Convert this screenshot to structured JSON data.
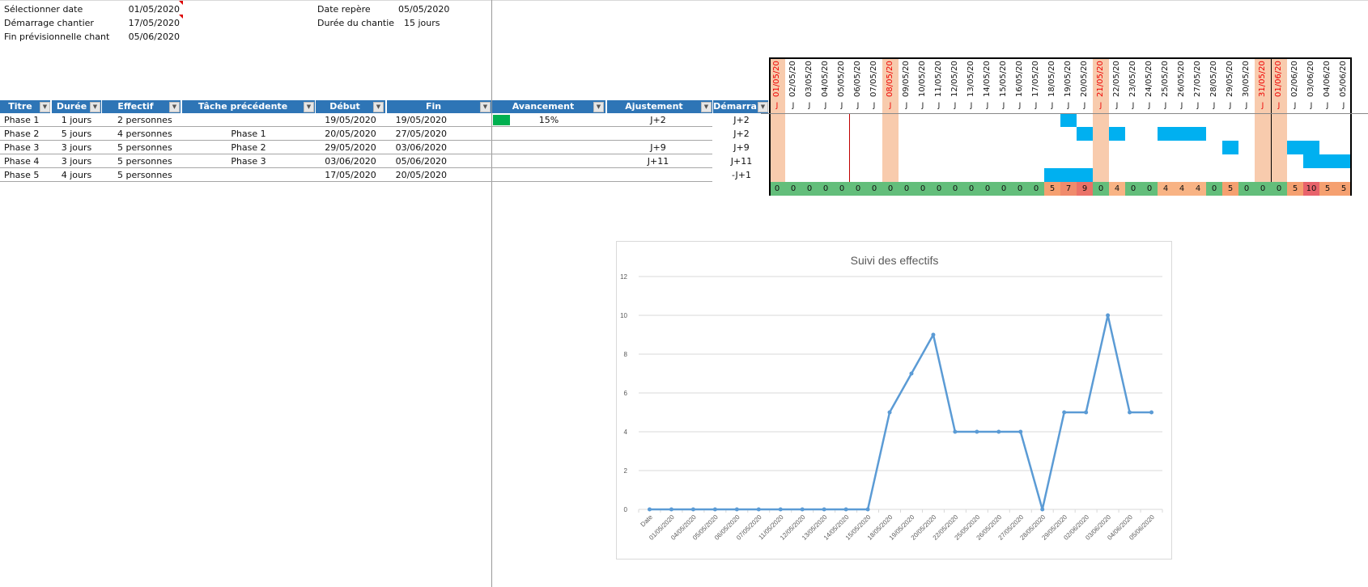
{
  "info": {
    "select_date_label": "Sélectionner date",
    "select_date_value": "01/05/2020",
    "start_label": "Démarrage chantier",
    "start_value": "17/05/2020",
    "end_label": "Fin prévisionnelle chant",
    "end_value": "05/06/2020",
    "ref_date_label": "Date repère",
    "ref_date_value": "05/05/2020",
    "duration_label": "Durée du chantie",
    "duration_value": "15 jours"
  },
  "table": {
    "headers": [
      "Titre",
      "Durée",
      "Effectif",
      "Tâche précédente",
      "Début",
      "Fin",
      "Avancement",
      "Ajustement",
      "Démarra"
    ],
    "rows": [
      {
        "titre": "Phase 1",
        "duree": "1 jours",
        "effectif": "2 personnes",
        "prec": "",
        "debut": "19/05/2020",
        "fin": "19/05/2020",
        "avancement": "15%",
        "avancement_fraction": 0.15,
        "ajustement": "J+2",
        "demarrage": "J+2"
      },
      {
        "titre": "Phase 2",
        "duree": "5 jours",
        "effectif": "4 personnes",
        "prec": "Phase 1",
        "debut": "20/05/2020",
        "fin": "27/05/2020",
        "avancement": "",
        "ajustement": "",
        "demarrage": "J+2"
      },
      {
        "titre": "Phase 3",
        "duree": "3 jours",
        "effectif": "5 personnes",
        "prec": "Phase 2",
        "debut": "29/05/2020",
        "fin": "03/06/2020",
        "avancement": "",
        "ajustement": "J+9",
        "demarrage": "J+9"
      },
      {
        "titre": "Phase 4",
        "duree": "3 jours",
        "effectif": "5 personnes",
        "prec": "Phase 3",
        "debut": "03/06/2020",
        "fin": "05/06/2020",
        "avancement": "",
        "ajustement": "J+11",
        "demarrage": "J+11"
      },
      {
        "titre": "Phase 5",
        "duree": "4 jours",
        "effectif": "5 personnes",
        "prec": "",
        "debut": "17/05/2020",
        "fin": "20/05/2020",
        "avancement": "",
        "ajustement": "",
        "demarrage": "-J+1"
      }
    ]
  },
  "gantt": {
    "dates": [
      "01/05/20",
      "02/05/20",
      "03/05/20",
      "04/05/20",
      "05/05/20",
      "06/05/20",
      "07/05/20",
      "08/05/20",
      "09/05/20",
      "10/05/20",
      "11/05/20",
      "12/05/20",
      "13/05/20",
      "14/05/20",
      "15/05/20",
      "16/05/20",
      "17/05/20",
      "18/05/20",
      "19/05/20",
      "20/05/20",
      "21/05/20",
      "22/05/20",
      "23/05/20",
      "24/05/20",
      "25/05/20",
      "26/05/20",
      "27/05/20",
      "28/05/20",
      "29/05/20",
      "30/05/20",
      "31/05/20",
      "01/06/20",
      "02/06/20",
      "03/06/20",
      "04/06/20",
      "05/06/20"
    ],
    "day_marker": "J",
    "holidays": [
      "01/05/20",
      "08/05/20",
      "21/05/20",
      "31/05/20",
      "01/06/20"
    ],
    "today_marker": "05/05/20",
    "bars": [
      [
        "19/05/20"
      ],
      [
        "20/05/20",
        "22/05/20",
        "25/05/20",
        "26/05/20",
        "27/05/20"
      ],
      [
        "29/05/20",
        "02/06/20",
        "03/06/20"
      ],
      [
        "03/06/20",
        "04/06/20",
        "05/06/20"
      ],
      [
        "18/05/20",
        "19/05/20",
        "20/05/20"
      ]
    ],
    "totals": [
      "0",
      "0",
      "0",
      "0",
      "0",
      "0",
      "0",
      "0",
      "0",
      "0",
      "0",
      "0",
      "0",
      "0",
      "0",
      "0",
      "0",
      "5",
      "7",
      "9",
      "0",
      "4",
      "0",
      "0",
      "4",
      "4",
      "4",
      "0",
      "5",
      "0",
      "0",
      "0",
      "5",
      "10",
      "5",
      "5"
    ],
    "colors": {
      "bar": "#00b0f0",
      "holiday": "#f8cbad",
      "header": "#2e75b6",
      "progress": "#00b050"
    }
  },
  "chart_data": {
    "type": "line",
    "title": "Suivi des effectifs",
    "categories": [
      "Date",
      "01/05/2020",
      "04/05/2020",
      "05/05/2020",
      "06/05/2020",
      "07/05/2020",
      "11/05/2020",
      "12/05/2020",
      "13/05/2020",
      "14/05/2020",
      "15/05/2020",
      "18/05/2020",
      "19/05/2020",
      "20/05/2020",
      "22/05/2020",
      "25/05/2020",
      "26/05/2020",
      "27/05/2020",
      "28/05/2020",
      "29/05/2020",
      "02/06/2020",
      "03/06/2020",
      "04/06/2020",
      "05/06/2020"
    ],
    "values": [
      0,
      0,
      0,
      0,
      0,
      0,
      0,
      0,
      0,
      0,
      0,
      5,
      7,
      9,
      4,
      4,
      4,
      4,
      0,
      5,
      5,
      10,
      5,
      5
    ],
    "ylim": [
      0,
      12
    ],
    "yticks": [
      0,
      2,
      4,
      6,
      8,
      10,
      12
    ],
    "grid": true,
    "legend": "none",
    "color": "#5b9bd5"
  }
}
